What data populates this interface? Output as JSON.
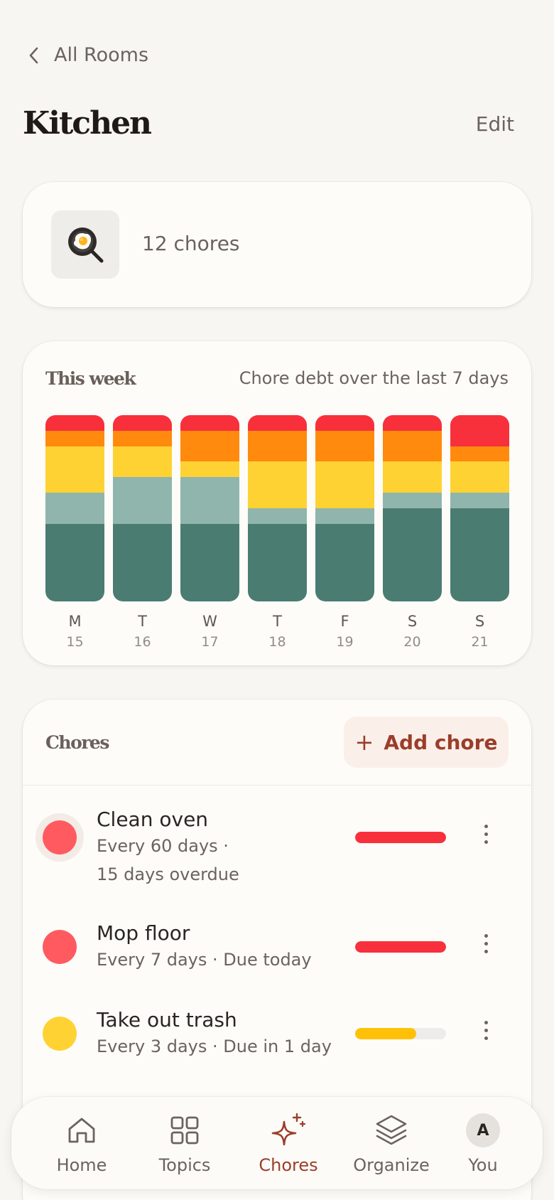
{
  "nav": {
    "back_label": "All Rooms"
  },
  "header": {
    "title": "Kitchen",
    "edit_label": "Edit"
  },
  "room": {
    "icon": "fried-egg-pan-icon",
    "chores_count_label": "12 chores"
  },
  "week": {
    "title": "This week",
    "subtitle": "Chore debt over the last 7 days",
    "days": [
      {
        "letter": "M",
        "date": "15"
      },
      {
        "letter": "T",
        "date": "16"
      },
      {
        "letter": "W",
        "date": "17"
      },
      {
        "letter": "T",
        "date": "18"
      },
      {
        "letter": "F",
        "date": "19"
      },
      {
        "letter": "S",
        "date": "20"
      },
      {
        "letter": "S",
        "date": "21"
      }
    ]
  },
  "chart_data": {
    "type": "bar",
    "stacked": true,
    "categories": [
      "M 15",
      "T 16",
      "W 17",
      "T 18",
      "F 19",
      "S 20",
      "S 21"
    ],
    "series": [
      {
        "color": "#f8303c",
        "values": [
          1,
          1,
          1,
          1,
          1,
          1,
          2
        ]
      },
      {
        "color": "#ff8a0e",
        "values": [
          1,
          1,
          2,
          2,
          2,
          2,
          1
        ]
      },
      {
        "color": "#ffd233",
        "values": [
          3,
          2,
          1,
          3,
          3,
          2,
          2
        ]
      },
      {
        "color": "#8fb5ac",
        "values": [
          2,
          3,
          3,
          1,
          1,
          1,
          1
        ]
      },
      {
        "color": "#4a7c72",
        "values": [
          5,
          5,
          5,
          5,
          5,
          6,
          6
        ]
      }
    ],
    "grid": false,
    "legend": "none"
  },
  "chores": {
    "title": "Chores",
    "add_label": "Add chore",
    "items": [
      {
        "name": "Clean oven",
        "meta_line1": "Every 60 days  ·",
        "meta_line2": "15 days overdue",
        "status_color": "#ff5a5f",
        "bar_color": "#f8303c",
        "progress": 1.0,
        "highlighted": true
      },
      {
        "name": "Mop floor",
        "meta_line1": "Every 7 days  ·  Due today",
        "meta_line2": "",
        "status_color": "#ff5a5f",
        "bar_color": "#f8303c",
        "progress": 1.0,
        "highlighted": false
      },
      {
        "name": "Take out trash",
        "meta_line1": "Every 3 days  ·  Due in 1 day",
        "meta_line2": "",
        "status_color": "#ffd233",
        "bar_color": "#ffc107",
        "progress": 0.67,
        "highlighted": false
      }
    ]
  },
  "tabbar": {
    "tabs": [
      {
        "label": "Home",
        "icon": "home-icon"
      },
      {
        "label": "Topics",
        "icon": "grid-icon"
      },
      {
        "label": "Chores",
        "icon": "sparkle-icon",
        "active": true
      },
      {
        "label": "Organize",
        "icon": "layers-icon"
      },
      {
        "label": "You",
        "icon": "avatar",
        "avatar_letter": "A"
      }
    ]
  },
  "colors": {
    "accent": "#9a3e2a",
    "background": "#f8f6f3",
    "card": "#fdfcf8"
  }
}
